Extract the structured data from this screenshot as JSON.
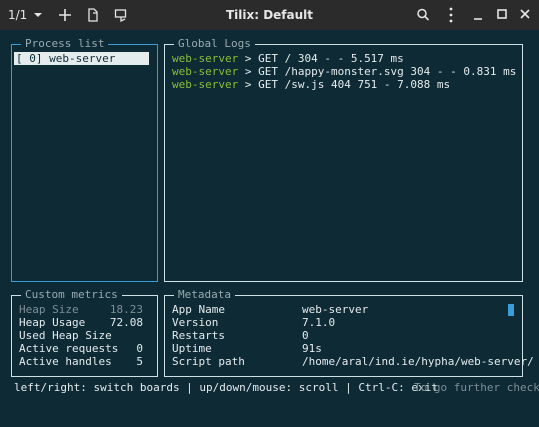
{
  "titlebar": {
    "tab_counter": "1/1",
    "title": "Tilix: Default",
    "icons": [
      "dropdown-icon",
      "add-terminal-icon",
      "split-icon",
      "sync-icon",
      "search-icon",
      "menu-icon",
      "minimize-icon",
      "maximize-icon",
      "close-icon"
    ]
  },
  "process_list": {
    "title": "Process list",
    "items": [
      "[ 0] web-server"
    ]
  },
  "global_logs": {
    "title": "Global Logs",
    "lines": [
      {
        "source": "web-server",
        "text": " > GET / 304 - - 5.517 ms"
      },
      {
        "source": "web-server",
        "text": " > GET /happy-monster.svg 304 - - 0.831 ms"
      },
      {
        "source": "web-server",
        "text": " > GET /sw.js 404 751 - 7.088 ms"
      }
    ]
  },
  "custom_metrics": {
    "title": "Custom metrics",
    "rows": [
      {
        "label": "Heap Size",
        "value": "18.23"
      },
      {
        "label": "Heap Usage",
        "value": "72.08"
      },
      {
        "label": "Used Heap Size",
        "value": ""
      },
      {
        "label": "Active requests",
        "value": "0"
      },
      {
        "label": "Active handles",
        "value": "5"
      }
    ]
  },
  "metadata": {
    "title": "Metadata",
    "rows": [
      {
        "label": "App Name",
        "value": "web-server"
      },
      {
        "label": "Version",
        "value": "7.1.0"
      },
      {
        "label": "Restarts",
        "value": "0"
      },
      {
        "label": "Uptime",
        "value": "91s"
      },
      {
        "label": "Script path",
        "value": "/home/aral/ind.ie/hypha/web-server/"
      }
    ]
  },
  "footer": {
    "help": "left/right: switch boards | up/down/mouse: scroll | Ctrl-C: exit",
    "hint": "To go further check"
  },
  "colors": {
    "background": "#0e2a35",
    "titlebar": "#2b2b2b",
    "accent": "#3a9cd8",
    "log_source": "#8bbd3a"
  }
}
